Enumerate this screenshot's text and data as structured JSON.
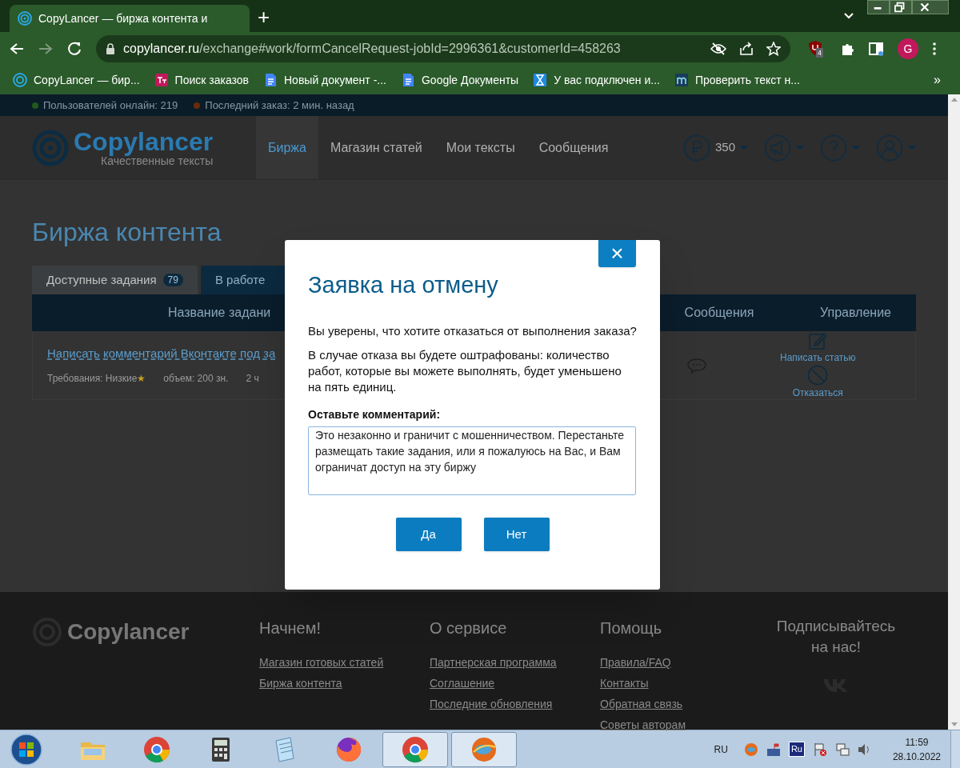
{
  "browser": {
    "tab": {
      "title": "CopyLancer — биржа контента и"
    },
    "new_tab": "+",
    "forward_disabled": true,
    "url": {
      "domain": "copylancer.ru",
      "path": "/exchange#work/formCancelRequest-jobId=2996361&customerId=458263"
    },
    "extension_badge": "4",
    "profile": "G",
    "bookmarks": [
      {
        "label": "CopyLancer — бир...",
        "kind": "copylancer"
      },
      {
        "label": "Поиск заказов",
        "kind": "tt"
      },
      {
        "label": "Новый документ -...",
        "kind": "docs"
      },
      {
        "label": "Google Документы",
        "kind": "docs"
      },
      {
        "label": "У вас подключен и...",
        "kind": "hourglass"
      },
      {
        "label": "Проверить текст н...",
        "kind": "m"
      }
    ],
    "more": "»"
  },
  "site": {
    "info_bar": [
      {
        "text": "Пользователей онлайн: 219",
        "color": "#1f5a1a"
      },
      {
        "text": "Последний заказ: 2 мин. назад",
        "color": "#6a2a0a"
      }
    ],
    "logo": {
      "name": "Copylancer",
      "tagline": "Качественные тексты"
    },
    "nav": [
      {
        "label": "Биржа",
        "selected": true
      },
      {
        "label": "Магазин статей",
        "selected": false
      },
      {
        "label": "Мои тексты",
        "selected": false
      },
      {
        "label": "Сообщения",
        "selected": false
      }
    ],
    "balance": "350",
    "heading": "Биржа контента",
    "tabs": [
      {
        "label": "Доступные задания",
        "badge": "79",
        "selected": false
      },
      {
        "label": "В работе",
        "selected": true
      }
    ],
    "table": {
      "columns": [
        "Название задани",
        "Сообщения",
        "Управление"
      ],
      "row": {
        "title": "Написать комментарий Вконтакте под за",
        "requirements": "Требования: Низкие",
        "star": "★",
        "volume": "объем: 200 зн.",
        "time": "2 ч",
        "actions": [
          "Написать статью",
          "Отказаться"
        ]
      }
    },
    "footer": {
      "logo": "Copylancer",
      "columns": [
        {
          "title": "Начнем!",
          "links": [
            "Магазин готовых статей",
            "Биржа контента"
          ]
        },
        {
          "title": "О сервисе",
          "links": [
            "Партнерская программа",
            "Соглашение",
            "Последние обновления"
          ]
        },
        {
          "title": "Помощь",
          "links": [
            "Правила/FAQ",
            "Контакты",
            "Обратная связь",
            "Советы авторам"
          ]
        }
      ],
      "subscribe": "Подписывайтесь на нас!"
    }
  },
  "dialog": {
    "title": "Заявка на отмену",
    "close": "×",
    "paragraphs": [
      "Вы уверены, что хотите отказаться от выполнения заказа?",
      "В случае отказа вы будете оштрафованы: количество работ, которые вы можете выполнять, будет уменьшено на пять единиц."
    ],
    "comment_label": "Оставьте комментарий:",
    "comment": "Это незаконно и граничит с мошенничеством. Перестаньте размещать такие задания, или я пожалуюсь на Вас, и Вам ограничат доступ на эту биржу",
    "buttons": [
      "Да",
      "Нет"
    ]
  },
  "taskbar": {
    "apps": [
      {
        "kind": "folder",
        "selected": false
      },
      {
        "kind": "chrome",
        "selected": false
      },
      {
        "kind": "calculator",
        "selected": false
      },
      {
        "kind": "notepad",
        "selected": false
      },
      {
        "kind": "firefox",
        "selected": false
      },
      {
        "kind": "chrome",
        "selected": true
      },
      {
        "kind": "globe",
        "selected": true
      }
    ],
    "language": "RU",
    "tray_text": "Ru",
    "time": "11:59",
    "date": "28.10.2022"
  }
}
